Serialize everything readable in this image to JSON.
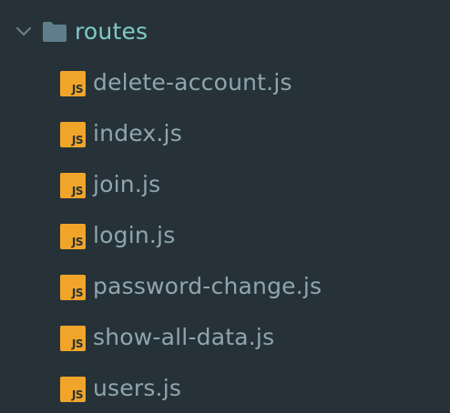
{
  "tree": {
    "folder": {
      "name": "routes",
      "expanded": true,
      "icon": "folder-icon",
      "chevron_icon": "chevron-down-icon",
      "label_color": "#80cbc4",
      "icon_color": "#607d8b"
    },
    "file_badge": {
      "icon": "js-file-icon",
      "text": "JS",
      "color": "#f0a52a"
    },
    "files": [
      {
        "name": "delete-account.js"
      },
      {
        "name": "index.js"
      },
      {
        "name": "join.js"
      },
      {
        "name": "login.js"
      },
      {
        "name": "password-change.js"
      },
      {
        "name": "show-all-data.js"
      },
      {
        "name": "users.js"
      }
    ]
  },
  "theme": {
    "background": "#263238",
    "file_text": "#8fa5b0"
  }
}
